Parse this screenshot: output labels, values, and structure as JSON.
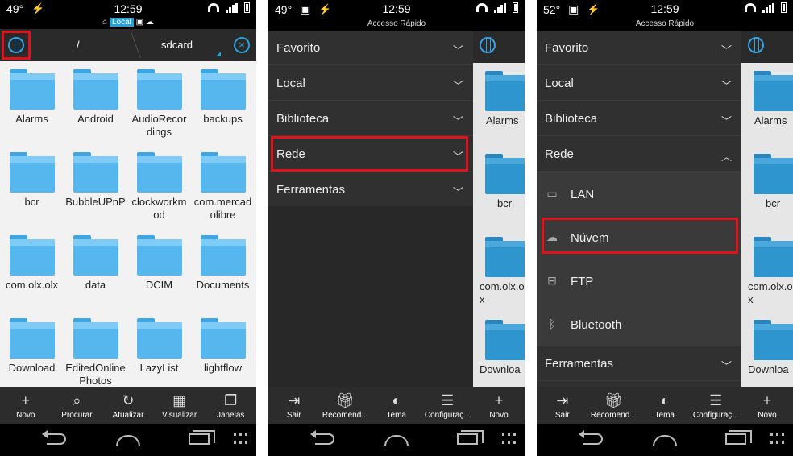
{
  "status_1": {
    "temp": "49°",
    "time": "12:59"
  },
  "status_2": {
    "temp": "49°",
    "time": "12:59"
  },
  "status_3": {
    "temp": "52°",
    "time": "12:59"
  },
  "panel_1": {
    "local_chip": "Local",
    "path_root": "/",
    "path_current": "sdcard",
    "folders": [
      "Alarms",
      "Android",
      "AudioRecordings",
      "backups",
      "bcr",
      "BubbleUPnP",
      "clockworkmod",
      "com.mercadolibre",
      "com.olx.olx",
      "data",
      "DCIM",
      "Documents",
      "Download",
      "EditedOnlinePhotos",
      "LazyList",
      "lightflow"
    ],
    "actions": [
      "Novo",
      "Procurar",
      "Atualizar",
      "Visualizar",
      "Janelas"
    ]
  },
  "drawer": {
    "header": "Accesso Rápido",
    "sections": [
      "Favorito",
      "Local",
      "Biblioteca",
      "Rede",
      "Ferramentas"
    ],
    "rede_items": [
      "LAN",
      "Núvem",
      "FTP",
      "Bluetooth"
    ],
    "actions": [
      "Sair",
      "Recomend...",
      "Tema",
      "Configuraç..."
    ],
    "peek_action": "Novo",
    "peek_folders": [
      "Alarms",
      "bcr",
      "com.olx.o\nx",
      "Downloa"
    ]
  },
  "icons": [
    "globe-icon",
    "close-icon",
    "add-icon",
    "search-icon",
    "refresh-icon",
    "grid-icon",
    "windows-icon",
    "exit-icon",
    "gift-icon",
    "theme-icon",
    "settings-icon",
    "lan-icon",
    "cloud-icon",
    "ftp-icon",
    "bluetooth-icon"
  ],
  "colors": {
    "highlight": "#e0121a",
    "accent": "#2aa1d6",
    "folder": "#56b7ee"
  }
}
